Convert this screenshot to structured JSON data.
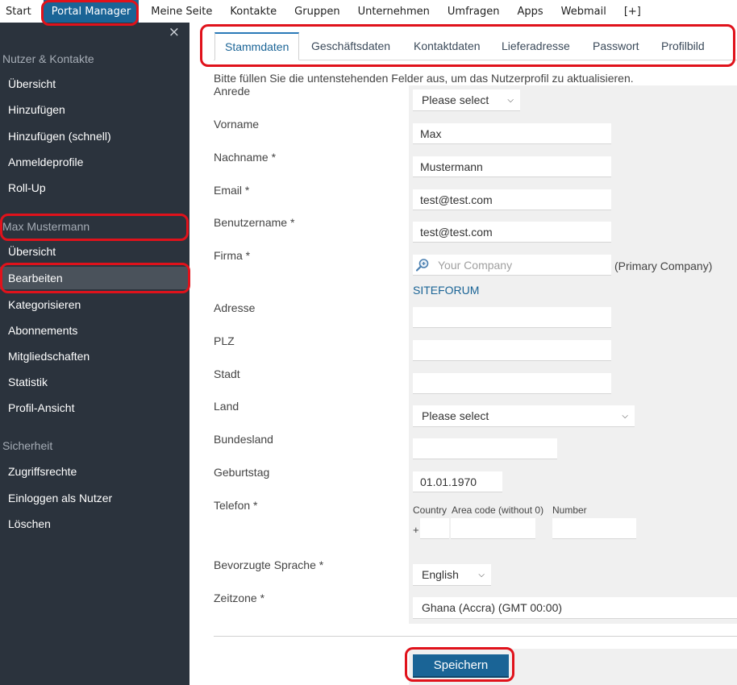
{
  "topnav": {
    "items": [
      "Start",
      "Portal Manager",
      "Meine Seite",
      "Kontakte",
      "Gruppen",
      "Unternehmen",
      "Umfragen",
      "Apps",
      "Webmail",
      "[+]"
    ],
    "active_index": 1
  },
  "sidebar": {
    "close_glyph": "×",
    "sections": [
      {
        "title": "Nutzer & Kontakte",
        "items": [
          "Übersicht",
          "Hinzufügen",
          "Hinzufügen (schnell)",
          "Anmeldeprofile",
          "Roll-Up"
        ]
      },
      {
        "title": "Max Mustermann",
        "items": [
          "Übersicht",
          "Bearbeiten",
          "Kategorisieren",
          "Abonnements",
          "Mitgliedschaften",
          "Statistik",
          "Profil-Ansicht"
        ]
      },
      {
        "title": "Sicherheit",
        "items": [
          "Zugriffsrechte",
          "Einloggen als Nutzer",
          "Löschen"
        ]
      }
    ],
    "active_item": "Bearbeiten"
  },
  "tabs": {
    "items": [
      "Stammdaten",
      "Geschäftsdaten",
      "Kontaktdaten",
      "Lieferadresse",
      "Passwort",
      "Profilbild"
    ],
    "active_index": 0
  },
  "form": {
    "intro": "Bitte füllen Sie die untenstehenden Felder aus, um das Nutzerprofil zu aktualisieren.",
    "anrede": {
      "label": "Anrede",
      "value": "Please select"
    },
    "vorname": {
      "label": "Vorname",
      "value": "Max"
    },
    "nachname": {
      "label": "Nachname *",
      "value": "Mustermann"
    },
    "email": {
      "label": "Email *",
      "value": "test@test.com"
    },
    "benutzername": {
      "label": "Benutzername *",
      "value": "test@test.com"
    },
    "firma": {
      "label": "Firma *",
      "placeholder": "Your Company",
      "note": "(Primary Company)",
      "link": "SITEFORUM"
    },
    "adresse": {
      "label": "Adresse",
      "value": ""
    },
    "plz": {
      "label": "PLZ",
      "value": ""
    },
    "stadt": {
      "label": "Stadt",
      "value": ""
    },
    "land": {
      "label": "Land",
      "value": "Please select"
    },
    "bundesland": {
      "label": "Bundesland",
      "value": ""
    },
    "geburtstag": {
      "label": "Geburtstag",
      "value": "01.01.1970"
    },
    "telefon": {
      "label": "Telefon *",
      "country_label": "Country",
      "area_label": "Area code (without 0)",
      "number_label": "Number",
      "plus": "+",
      "country": "",
      "area": "",
      "number": ""
    },
    "sprache": {
      "label": "Bevorzugte Sprache *",
      "value": "English"
    },
    "zeitzone": {
      "label": "Zeitzone *",
      "value": "Ghana (Accra) (GMT 00:00)"
    }
  },
  "actions": {
    "save_label": "Speichern"
  },
  "colors": {
    "accent": "#1a6496",
    "sidebar_bg": "#2b333d",
    "annotation": "#e0121b"
  }
}
